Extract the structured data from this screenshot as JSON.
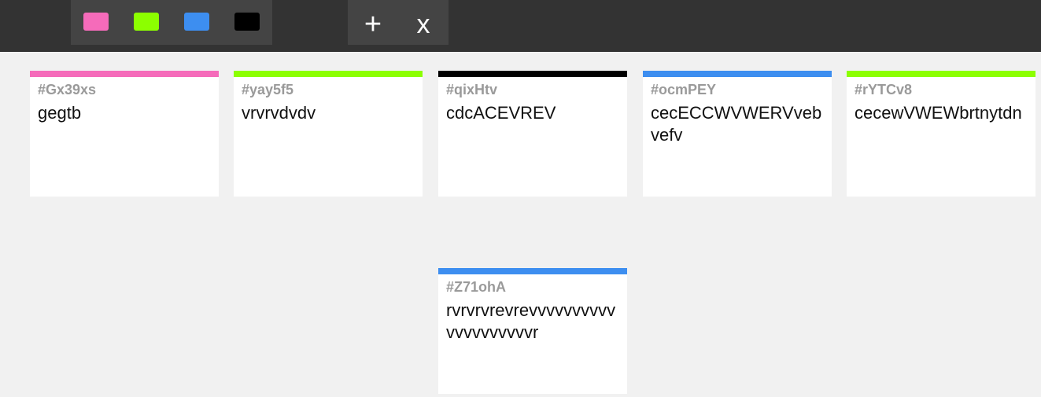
{
  "colors": {
    "toolbar_bg": "#333333",
    "toolbar_group_bg": "#444444",
    "page_bg": "#f1f1f1",
    "pink": "#f56bba",
    "green": "#8cff00",
    "blue": "#3d8ef0",
    "black": "#000000"
  },
  "toolbar": {
    "swatches": [
      {
        "name": "pink",
        "color": "#f56bba"
      },
      {
        "name": "green",
        "color": "#8cff00"
      },
      {
        "name": "blue",
        "color": "#3d8ef0"
      },
      {
        "name": "black",
        "color": "#000000"
      }
    ],
    "add_label": "+",
    "close_label": "x"
  },
  "notes": [
    {
      "id": "#Gx39xs",
      "text": "gegtb",
      "color": "#f56bba"
    },
    {
      "id": "#yay5f5",
      "text": "vrvrvdvdv",
      "color": "#8cff00"
    },
    {
      "id": "#qixHtv",
      "text": "cdcACEVREV",
      "color": "#000000"
    },
    {
      "id": "#ocmPEY",
      "text": "cecECCWVWERVvebvefv",
      "color": "#3d8ef0"
    },
    {
      "id": "#rYTCv8",
      "text": "cecewVWEWbrtnytdn",
      "color": "#8cff00"
    },
    {
      "id": "#Z71ohA",
      "text": "rvrvrvrevrevvvvvvvvvvvvvvvvvvvvr",
      "color": "#3d8ef0"
    }
  ]
}
